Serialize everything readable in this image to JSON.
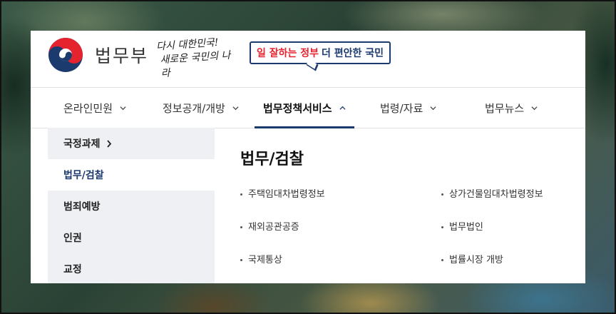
{
  "header": {
    "brand_name": "법무부",
    "slogan_handwritten": [
      "다시 대한민국!",
      "새로운 국민의 나라"
    ],
    "slogan_red": "일 잘하는 정부",
    "slogan_blue": "더 편안한 국민"
  },
  "nav": {
    "items": [
      {
        "label": "온라인민원"
      },
      {
        "label": "정보공개/개방"
      },
      {
        "label": "법무정책서비스"
      },
      {
        "label": "법령/자료"
      },
      {
        "label": "법무뉴스"
      }
    ]
  },
  "sidebar": {
    "items": [
      {
        "label": "국정과제"
      },
      {
        "label": "법무/검찰"
      },
      {
        "label": "범죄예방"
      },
      {
        "label": "인권"
      },
      {
        "label": "교정"
      }
    ]
  },
  "content": {
    "title": "법무/검찰",
    "links_left": [
      "주택임대차법령정보",
      "재외공관공증",
      "국제통상"
    ],
    "links_right": [
      "상가건물임대차법령정보",
      "법무법인",
      "법률시장 개방"
    ]
  },
  "colors": {
    "accent": "#1b3a6e",
    "slogan_red": "#e5232f",
    "sidebar_bg": "#eef0f4"
  }
}
